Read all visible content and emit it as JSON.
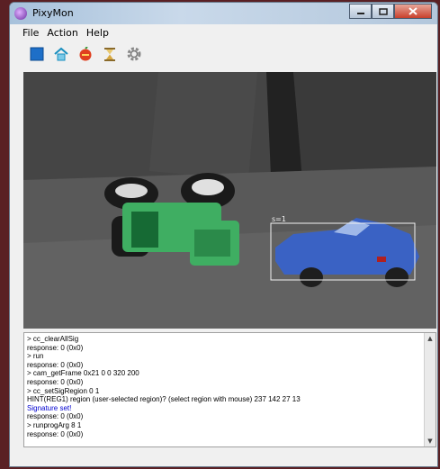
{
  "window": {
    "title": "PixyMon"
  },
  "menu": {
    "items": [
      "File",
      "Action",
      "Help"
    ]
  },
  "video": {
    "region_label": "s=1"
  },
  "console": {
    "lines": [
      {
        "text": "> cc_clearAllSig",
        "color": "#000000"
      },
      {
        "text": "response: 0 (0x0)",
        "color": "#000000"
      },
      {
        "text": "> run",
        "color": "#000000"
      },
      {
        "text": "response: 0 (0x0)",
        "color": "#000000"
      },
      {
        "text": "> cam_getFrame 0x21 0 0 320 200",
        "color": "#000000"
      },
      {
        "text": "response: 0 (0x0)",
        "color": "#000000"
      },
      {
        "text": "> cc_setSigRegion 0 1",
        "color": "#000000"
      },
      {
        "text": "HINT(REG1)  region (user-selected region)? (select region with mouse) 237 142 27 13",
        "color": "#000000"
      },
      {
        "text": "Signature set!",
        "color": "#0000d0"
      },
      {
        "text": "response: 0 (0x0)",
        "color": "#000000"
      },
      {
        "text": "> runprogArg 8 1",
        "color": "#000000"
      },
      {
        "text": "response: 0 (0x0)",
        "color": "#000000"
      }
    ]
  },
  "toolbar": {
    "icons": [
      "stop-square-icon",
      "home-icon",
      "ranger-icon",
      "hourglass-icon",
      "gear-icon"
    ]
  }
}
